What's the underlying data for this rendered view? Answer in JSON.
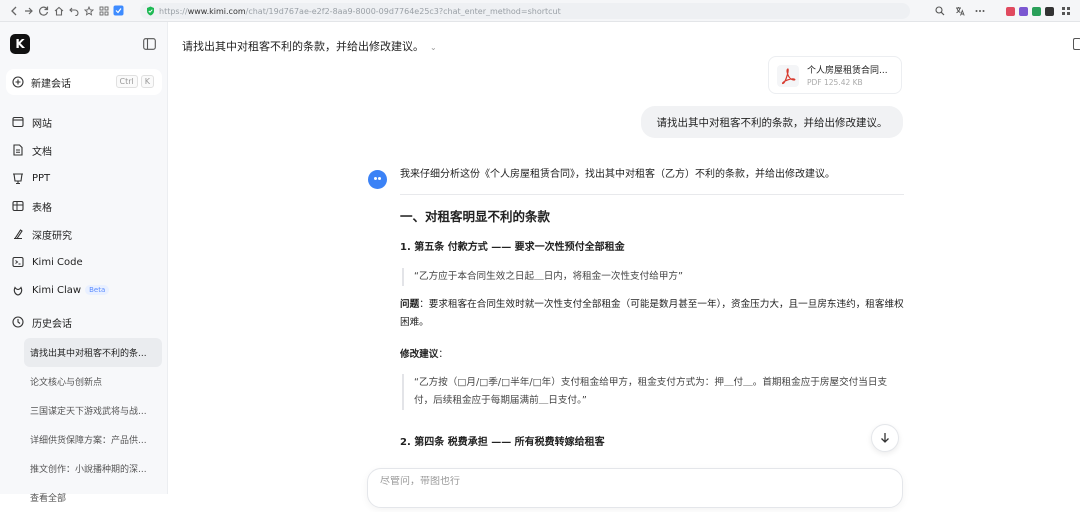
{
  "browser": {
    "url_secure": "https://",
    "url_host": "www.kimi.com",
    "url_path": "/chat/19d767ae-e2f2-8aa9-8000-09d7764e25c3?chat_enter_method=shortcut",
    "ext_colors": [
      "#e04a5f",
      "#7b57d1",
      "#2aa05a",
      "#333333"
    ]
  },
  "sidebar": {
    "logo": "K",
    "new_chat": {
      "label": "新建会话",
      "shortcut": [
        "Ctrl",
        "K"
      ]
    },
    "nav": [
      {
        "label": "网站",
        "icon": "website-icon"
      },
      {
        "label": "文档",
        "icon": "document-icon"
      },
      {
        "label": "PPT",
        "icon": "ppt-icon"
      },
      {
        "label": "表格",
        "icon": "table-icon"
      },
      {
        "label": "深度研究",
        "icon": "research-icon"
      },
      {
        "label": "Kimi Code",
        "icon": "code-icon"
      },
      {
        "label": "Kimi Claw",
        "icon": "claw-icon",
        "badge": "Beta"
      }
    ],
    "history_label": "历史会话",
    "history": [
      "请找出其中对租客不利的条...",
      "论文核心与创新点",
      "三国谋定天下游戏武将与战...",
      "详细供货保障方案：产品供...",
      "推文创作：小說播种期的深...",
      "查看全部"
    ]
  },
  "header": {
    "title": "请找出其中对租客不利的条款，并给出修改建议。"
  },
  "file": {
    "name": "个人房屋租赁合同...",
    "meta": "PDF 125.42 KB"
  },
  "user_message": "请找出其中对租客不利的条款，并给出修改建议。",
  "answer": {
    "intro": "我来仔细分析这份《个人房屋租赁合同》，找出其中对租客（乙方）不利的条款，并给出修改建议。",
    "h1": "一、对租客明显不利的条款",
    "item1_title": "1. 第五条 付款方式 —— 要求一次性预付全部租金",
    "item1_quote": "“乙方应于本合同生效之日起＿日内，将租金一次性支付给甲方”",
    "problem_label": "问题",
    "problem_text": "：要求租客在合同生效时就一次性支付全部租金（可能是数月甚至一年），资金压力大，且一旦房东违约，租客维权困难。",
    "suggest_label": "修改建议",
    "suggest_colon": "：",
    "suggest_quote": "“乙方按（□月/□季/□半年/□年）支付租金给甲方，租金支付方式为：押＿付＿。首期租金应于房屋交付当日支付，后续租金应于每期届满前＿日支付。”",
    "item2_title": "2. 第四条 税费承担 —— 所有税费转嫁给租客"
  },
  "input": {
    "placeholder": "尽管问，带图也行"
  }
}
